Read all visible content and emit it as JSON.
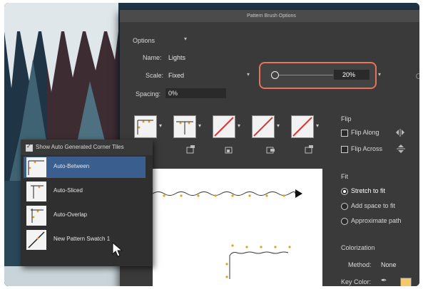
{
  "dialog": {
    "title": "Pattern Brush Options",
    "options_label": "Options",
    "name_label": "Name:",
    "name_value": "Lights",
    "scale_label": "Scale:",
    "scale_value": "Fixed",
    "scale_percent": "20%",
    "scale_fraction": 0.2,
    "spacing_label": "Spacing:",
    "spacing_value": "0%"
  },
  "flip": {
    "label": "Flip",
    "along": "Flip Along",
    "across": "Flip Across"
  },
  "fit": {
    "label": "Fit",
    "options": [
      "Stretch to fit",
      "Add space to fit",
      "Approximate path"
    ],
    "selected": "Stretch to fit"
  },
  "colorization": {
    "label": "Colorization",
    "method_label": "Method:",
    "method_value": "None",
    "key_color_label": "Key Color:",
    "key_color": "#f5c86a"
  },
  "tile_menu": {
    "show_auto_label": "Show Auto Generated Corner Tiles",
    "items": [
      "Auto-Between",
      "Auto-Sliced",
      "Auto-Overlap",
      "New Pattern Swatch 1"
    ],
    "selected": "Auto-Between"
  },
  "colors": {
    "accent_outline": "#e8735b",
    "selection": "#3a5f8e",
    "panel": "#3a3a3a"
  }
}
